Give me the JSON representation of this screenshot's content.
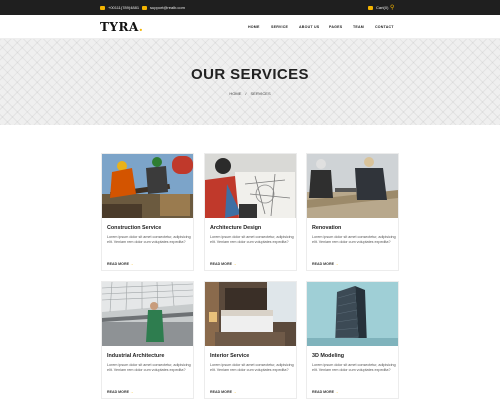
{
  "topbar": {
    "phone": "+00111(789)4881",
    "email": "support@realb.com",
    "cart": "Cart(0)"
  },
  "header": {
    "logo": "TYRA",
    "logo_dot": ".",
    "nav": [
      "HOME",
      "SERVICE",
      "ABOUT US",
      "PAGES",
      "TEAM",
      "CONTACT"
    ]
  },
  "hero": {
    "title": "OUR SERVICES",
    "breadcrumb": [
      "HOME",
      "/",
      "SERVICES"
    ]
  },
  "services": [
    {
      "title": "Construction Service",
      "description": "Lorem ipsum dolor sit amet consectetur, adipisicing elit. Veniam rem dolor cum voluptates expedita?",
      "more": "READ MORE",
      "image": "construction-workers-photo"
    },
    {
      "title": "Architecture Design",
      "description": "Lorem ipsum dolor sit amet consectetur, adipisicing elit. Veniam rem dolor cum voluptates expedita?",
      "more": "READ MORE",
      "image": "architect-blueprint-photo"
    },
    {
      "title": "Renovation",
      "description": "Lorem ipsum dolor sit amet consectetur, adipisicing elit. Veniam rem dolor cum voluptates expedita?",
      "more": "READ MORE",
      "image": "renovation-workers-photo"
    },
    {
      "title": "Industrial Architecture",
      "description": "Lorem ipsum dolor sit amet consectetur, adipisicing elit. Veniam rem dolor cum voluptates expedita?",
      "more": "READ MORE",
      "image": "industrial-hall-photo"
    },
    {
      "title": "Interior Service",
      "description": "Lorem ipsum dolor sit amet consectetur, adipisicing elit. Veniam rem dolor cum voluptates expedita?",
      "more": "READ MORE",
      "image": "bedroom-interior-photo"
    },
    {
      "title": "3D Modeling",
      "description": "Lorem ipsum dolor sit amet consectetur, adipisicing elit. Veniam rem dolor cum voluptates expedita?",
      "more": "READ MORE",
      "image": "skyscraper-photo"
    }
  ],
  "colors": {
    "accent": "#f4b400",
    "topbar": "#1f1f1f",
    "text": "#222222"
  }
}
